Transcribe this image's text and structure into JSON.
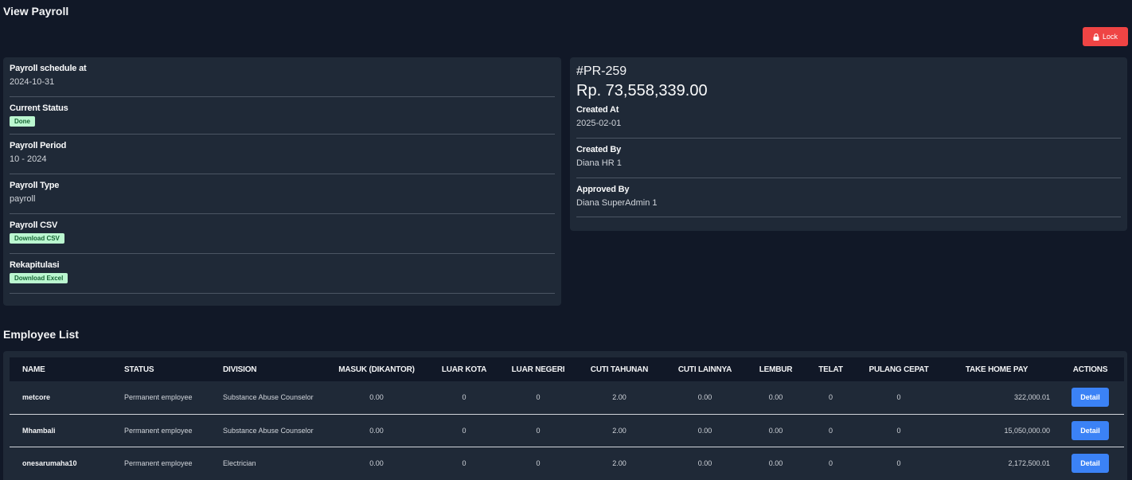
{
  "page": {
    "title": "View Payroll"
  },
  "header": {
    "lock_label": "Lock"
  },
  "summary": {
    "schedule_label": "Payroll schedule at",
    "schedule_value": "2024-10-31",
    "status_label": "Current Status",
    "status_badge": "Done",
    "period_label": "Payroll Period",
    "period_value": "10 - 2024",
    "type_label": "Payroll Type",
    "type_value": "payroll",
    "csv_label": "Payroll CSV",
    "csv_link": "Download CSV",
    "recap_label": "Rekapitulasi",
    "recap_link": "Download Excel"
  },
  "detail": {
    "id": "#PR-259",
    "amount": "Rp. 73,558,339.00",
    "created_at_label": "Created At",
    "created_at_value": "2025-02-01",
    "created_by_label": "Created By",
    "created_by_value": "Diana HR 1",
    "approved_by_label": "Approved By",
    "approved_by_value": "Diana SuperAdmin 1"
  },
  "employees": {
    "title": "Employee List",
    "columns": [
      "NAME",
      "STATUS",
      "DIVISION",
      "MASUK (DIKANTOR)",
      "LUAR KOTA",
      "LUAR NEGERI",
      "CUTI TAHUNAN",
      "CUTI LAINNYA",
      "LEMBUR",
      "TELAT",
      "PULANG CEPAT",
      "TAKE HOME PAY",
      "ACTIONS"
    ],
    "rows": [
      {
        "name": "metcore",
        "status": "Permanent employee",
        "division": "Substance Abuse Counselor",
        "masuk": "0.00",
        "luar_kota": "0",
        "luar_negeri": "0",
        "cuti_tahunan": "2.00",
        "cuti_lainnya": "0.00",
        "lembur": "0.00",
        "telat": "0",
        "pulang_cepat": "0",
        "take_home_pay": "322,000.01",
        "action": "Detail"
      },
      {
        "name": "Mhambali",
        "status": "Permanent employee",
        "division": "Substance Abuse Counselor",
        "masuk": "0.00",
        "luar_kota": "0",
        "luar_negeri": "0",
        "cuti_tahunan": "2.00",
        "cuti_lainnya": "0.00",
        "lembur": "0.00",
        "telat": "0",
        "pulang_cepat": "0",
        "take_home_pay": "15,050,000.00",
        "action": "Detail"
      },
      {
        "name": "onesarumaha10",
        "status": "Permanent employee",
        "division": "Electrician",
        "masuk": "0.00",
        "luar_kota": "0",
        "luar_negeri": "0",
        "cuti_tahunan": "2.00",
        "cuti_lainnya": "0.00",
        "lembur": "0.00",
        "telat": "0",
        "pulang_cepat": "0",
        "take_home_pay": "2,172,500.01",
        "action": "Detail"
      }
    ]
  },
  "colors": {
    "background": "#111827",
    "card": "#1f2937",
    "lock": "#ef4444",
    "detail_button": "#3b82f6",
    "badge_bg": "#bbf7d0",
    "badge_text": "#166534"
  },
  "icons": {
    "lock": "lock-icon"
  }
}
